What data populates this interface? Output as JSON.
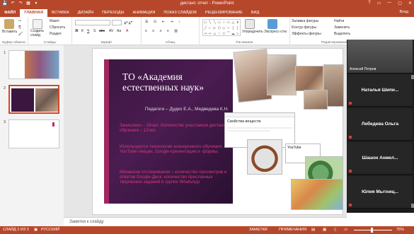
{
  "window": {
    "title": "дистант. отчет - PowerPoint",
    "controls": [
      "?",
      "▭",
      "—",
      "▢",
      "✕"
    ]
  },
  "qat": {
    "save": "💾",
    "undo": "↶",
    "redo": "↷",
    "start": "▦",
    "more": "▾"
  },
  "tabs": [
    {
      "label": "ФАЙЛ"
    },
    {
      "label": "ГЛАВНАЯ"
    },
    {
      "label": "ВСТАВКА"
    },
    {
      "label": "ДИЗАЙН"
    },
    {
      "label": "ПЕРЕХОДЫ"
    },
    {
      "label": "АНИМАЦИЯ"
    },
    {
      "label": "ПОКАЗ СЛАЙДОВ"
    },
    {
      "label": "РЕЦЕНЗИРОВАНИЕ"
    },
    {
      "label": "ВИД"
    }
  ],
  "account": "Вход",
  "ribbon": {
    "clipboard": {
      "paste": "Вставить",
      "label": "Буфер обмена"
    },
    "slides": {
      "new_slide": "Создать слайд",
      "layout": "Макет",
      "reset": "Сбросить",
      "section": "Раздел",
      "label": "Слайды"
    },
    "font": {
      "name": "",
      "size": "",
      "label": "Шрифт",
      "buttons": [
        "Ж",
        "К",
        "Ч",
        "S",
        "abc",
        "AV",
        "Aa",
        "A"
      ]
    },
    "paragraph": {
      "label": "Абзац"
    },
    "drawing": {
      "arrange": "Упорядочить",
      "quick_styles": "Экспресс-стили",
      "fill": "Заливка фигуры",
      "outline": "Контур фигуры",
      "effects": "Эффекты фигуры",
      "label": "Рисование"
    },
    "editing": {
      "find": "Найти",
      "replace": "Заменить",
      "select": "Выделить",
      "label": "Редактирование"
    }
  },
  "thumbnails": [
    {
      "num": "1"
    },
    {
      "num": "2"
    },
    {
      "num": "3"
    }
  ],
  "slide": {
    "title": "ТО «Академия естественных наук»",
    "subtitle": "Педагоги – Дудко Е.А., Медведева К.Н.",
    "enrolled": "Зачислено – 19чел. Количество участников дистант. обучения – 12чел.",
    "technologies": "Используются технологии асинхронного обучения: YouTube-лекции, Google-презентации и -формы.",
    "mechanism": "Механизм отслеживания – количество просмотров и ответов Google-Диск, количество присланных творческих заданий в группе WhatsApp"
  },
  "embedded": {
    "form_title": "Свойства веществ",
    "youtube": "YouTube"
  },
  "notes": "Заметки к слайду",
  "call": {
    "self_name": "Алексей Петров",
    "participants": [
      {
        "name": "Наталья Шипи..."
      },
      {
        "name": "Лебедева Ольга"
      },
      {
        "name": "Шашок Анжел..."
      },
      {
        "name": "Юлия Мытниц..."
      }
    ]
  },
  "status": {
    "slide_info": "СЛАЙД 2 ИЗ 3",
    "language": "РУССКИЙ",
    "notes": "ЗАМЕТКИ",
    "comments": "ПРИМЕЧАНИЯ",
    "zoom": "75%"
  },
  "colors": {
    "accent": "#b7472a",
    "slide_bg": "#3b1740",
    "slide_text": "#d23c7a"
  }
}
